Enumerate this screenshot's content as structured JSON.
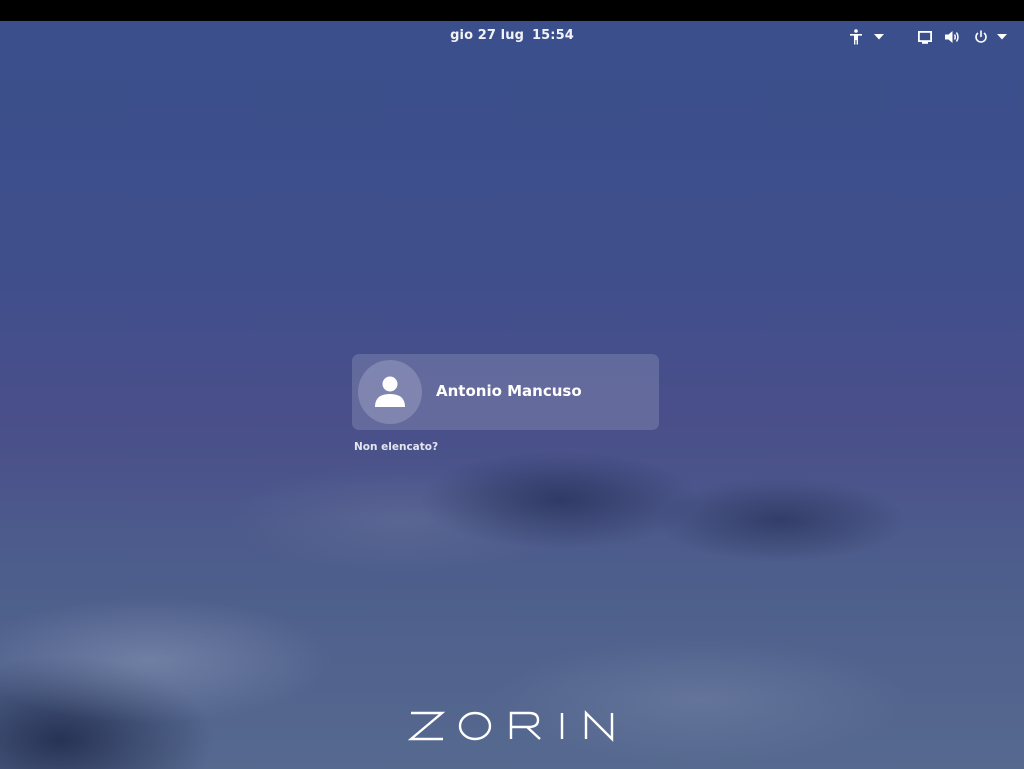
{
  "top_bar": {
    "date": "gio 27 lug",
    "time": "15:54",
    "accessibility_icon": "accessibility-icon",
    "display_icon": "display-icon",
    "volume_icon": "volume-icon",
    "power_icon": "power-icon",
    "caret_icon": "chevron-down-icon"
  },
  "login": {
    "user_name": "Antonio Mancuso",
    "avatar_icon": "user-avatar-icon",
    "not_listed_label": "Non elencato?"
  },
  "branding": {
    "logo_text": "ZORIN"
  },
  "colors": {
    "background_top": "#394f8b",
    "background_bottom": "#56698f",
    "text": "#ffffff"
  }
}
